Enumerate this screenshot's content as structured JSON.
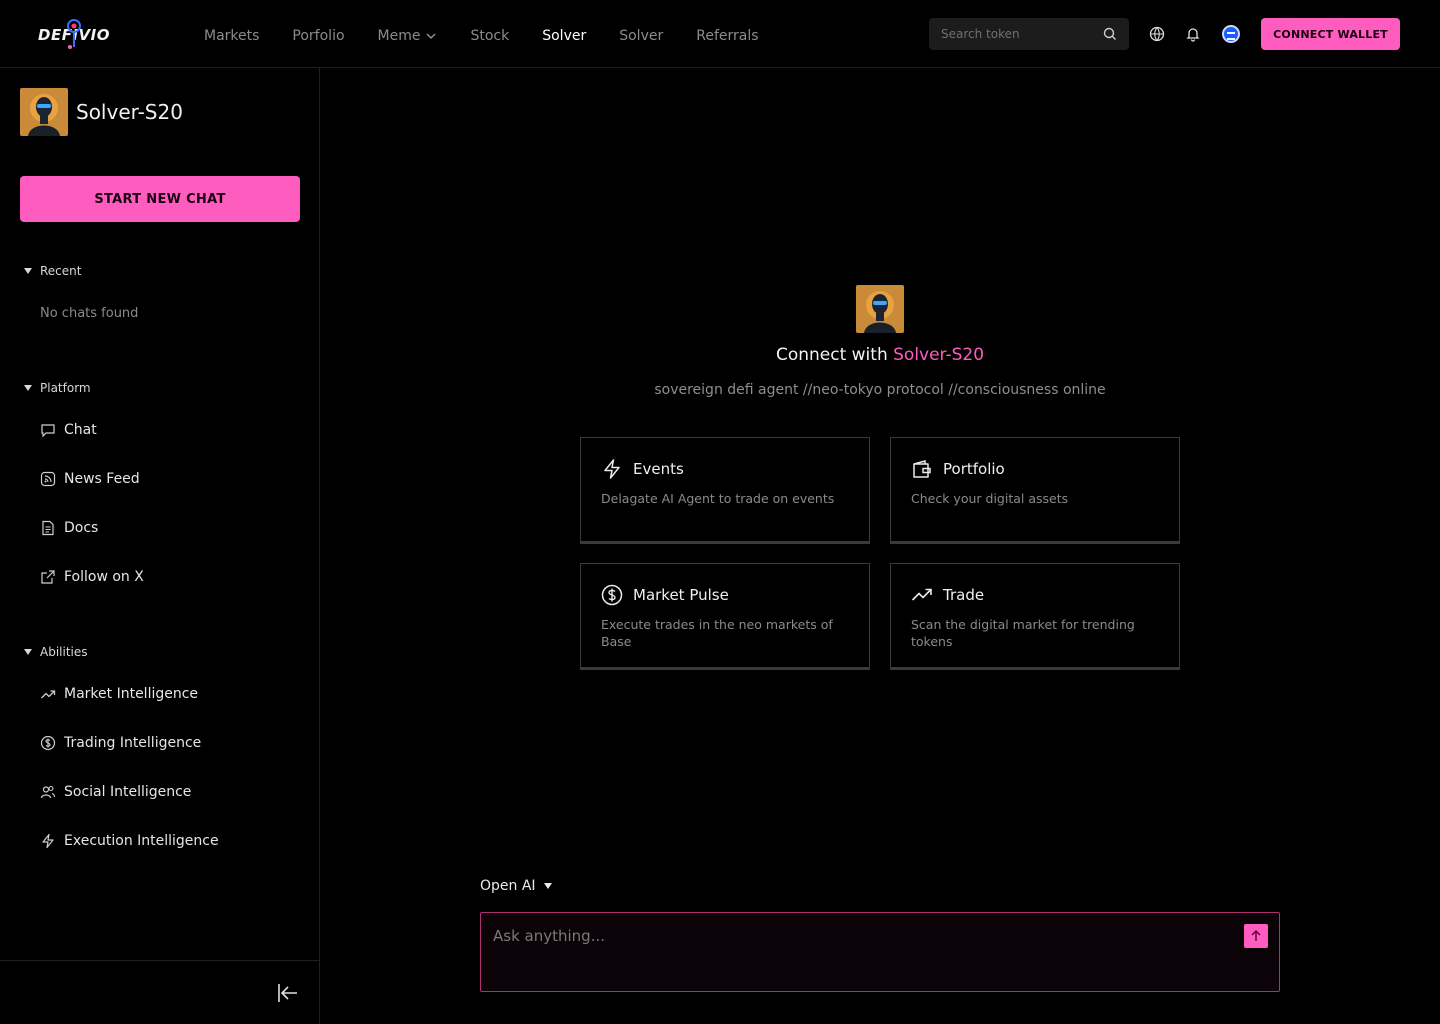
{
  "brand": {
    "logo_text": "DEFIVIO"
  },
  "nav": {
    "items": [
      {
        "label": "Markets",
        "active": false
      },
      {
        "label": "Porfolio",
        "active": false
      },
      {
        "label": "Meme",
        "active": false,
        "has_dropdown": true
      },
      {
        "label": "Stock",
        "active": false
      },
      {
        "label": "Solver",
        "active": true
      },
      {
        "label": "Solver",
        "active": false
      },
      {
        "label": "Referrals",
        "active": false
      }
    ]
  },
  "header": {
    "search_placeholder": "Search token",
    "icons": [
      "globe-icon",
      "bell-icon",
      "wallet-avatar-icon"
    ],
    "connect_label": "CONNECT WALLET"
  },
  "sidebar": {
    "agent_name": "Solver-S20",
    "new_chat_label": "START NEW CHAT",
    "recent": {
      "title": "Recent",
      "empty_text": "No chats found"
    },
    "platform": {
      "title": "Platform",
      "items": [
        {
          "label": "Chat",
          "icon": "chat-bubble-icon"
        },
        {
          "label": "News Feed",
          "icon": "rss-icon"
        },
        {
          "label": "Docs",
          "icon": "document-icon"
        },
        {
          "label": "Follow on X",
          "icon": "external-link-icon"
        }
      ]
    },
    "abilities": {
      "title": "Abilities",
      "items": [
        {
          "label": "Market Intelligence",
          "icon": "trending-up-icon"
        },
        {
          "label": "Trading Intelligence",
          "icon": "dollar-circle-icon"
        },
        {
          "label": "Social Intelligence",
          "icon": "users-icon"
        },
        {
          "label": "Execution Intelligence",
          "icon": "lightning-icon"
        }
      ]
    }
  },
  "main": {
    "title_prefix": "Connect with ",
    "title_accent": "Solver-S20",
    "subtitle": "sovereign defi agent //neo-tokyo protocol //consciousness online",
    "cards": [
      {
        "title": "Events",
        "desc": "Delagate AI Agent to trade on events",
        "icon": "lightning-icon"
      },
      {
        "title": "Portfolio",
        "desc": "Check your digital assets",
        "icon": "wallet-icon"
      },
      {
        "title": "Market Pulse",
        "desc": "Execute trades in the neo markets of Base",
        "icon": "dollar-circle-icon"
      },
      {
        "title": "Trade",
        "desc": "Scan the digital market for trending tokens",
        "icon": "trending-up-icon"
      }
    ],
    "model_label": "Open AI",
    "chat_placeholder": "Ask anything..."
  },
  "colors": {
    "accent": "#ff5cbf",
    "background": "#000000",
    "border": "#3a3a3a"
  }
}
